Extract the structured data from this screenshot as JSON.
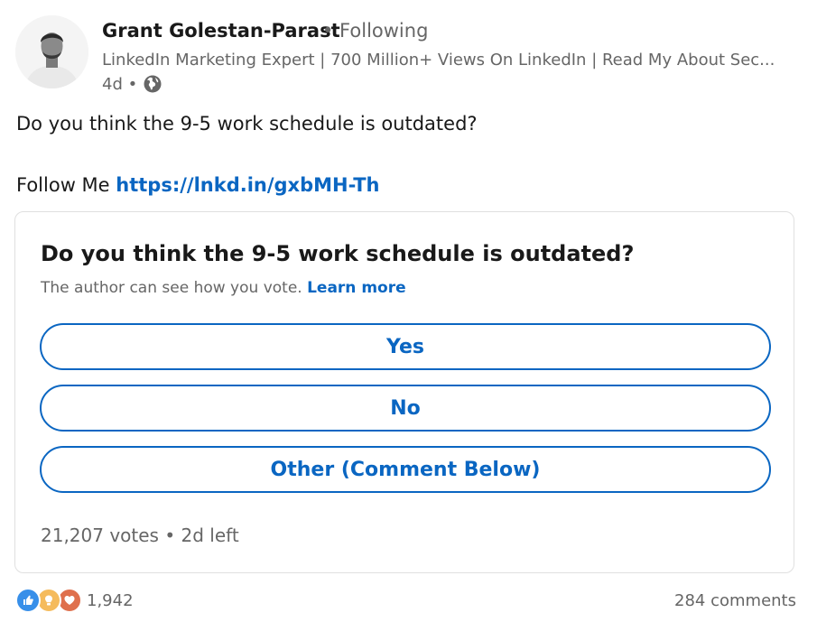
{
  "author": {
    "name": "Grant Golestan-Parast",
    "follow_status": "• Following",
    "headline": "LinkedIn Marketing Expert | 700 Million+ Views On LinkedIn | Read My About Sec...",
    "time": "4d •"
  },
  "post": {
    "text": "Do you think the 9-5 work schedule is outdated?",
    "follow_prefix": "Follow Me",
    "follow_link": "https://lnkd.in/gxbMH-Th"
  },
  "poll": {
    "question": "Do you think the 9-5 work schedule is outdated?",
    "note": "The author can see how you vote.",
    "learn_more": "Learn more",
    "options": [
      "Yes",
      "No",
      "Other (Comment Below)"
    ],
    "votes": "21,207 votes",
    "time_left": "• 2d left"
  },
  "social": {
    "reaction_count": "1,942",
    "comments": "284 comments"
  },
  "colors": {
    "accent": "#0a66c2",
    "like": "#378fe9",
    "insightful": "#f5bb5c",
    "love": "#df704d"
  },
  "icons": [
    "globe-icon",
    "like-reaction-icon",
    "insightful-reaction-icon",
    "love-reaction-icon"
  ]
}
